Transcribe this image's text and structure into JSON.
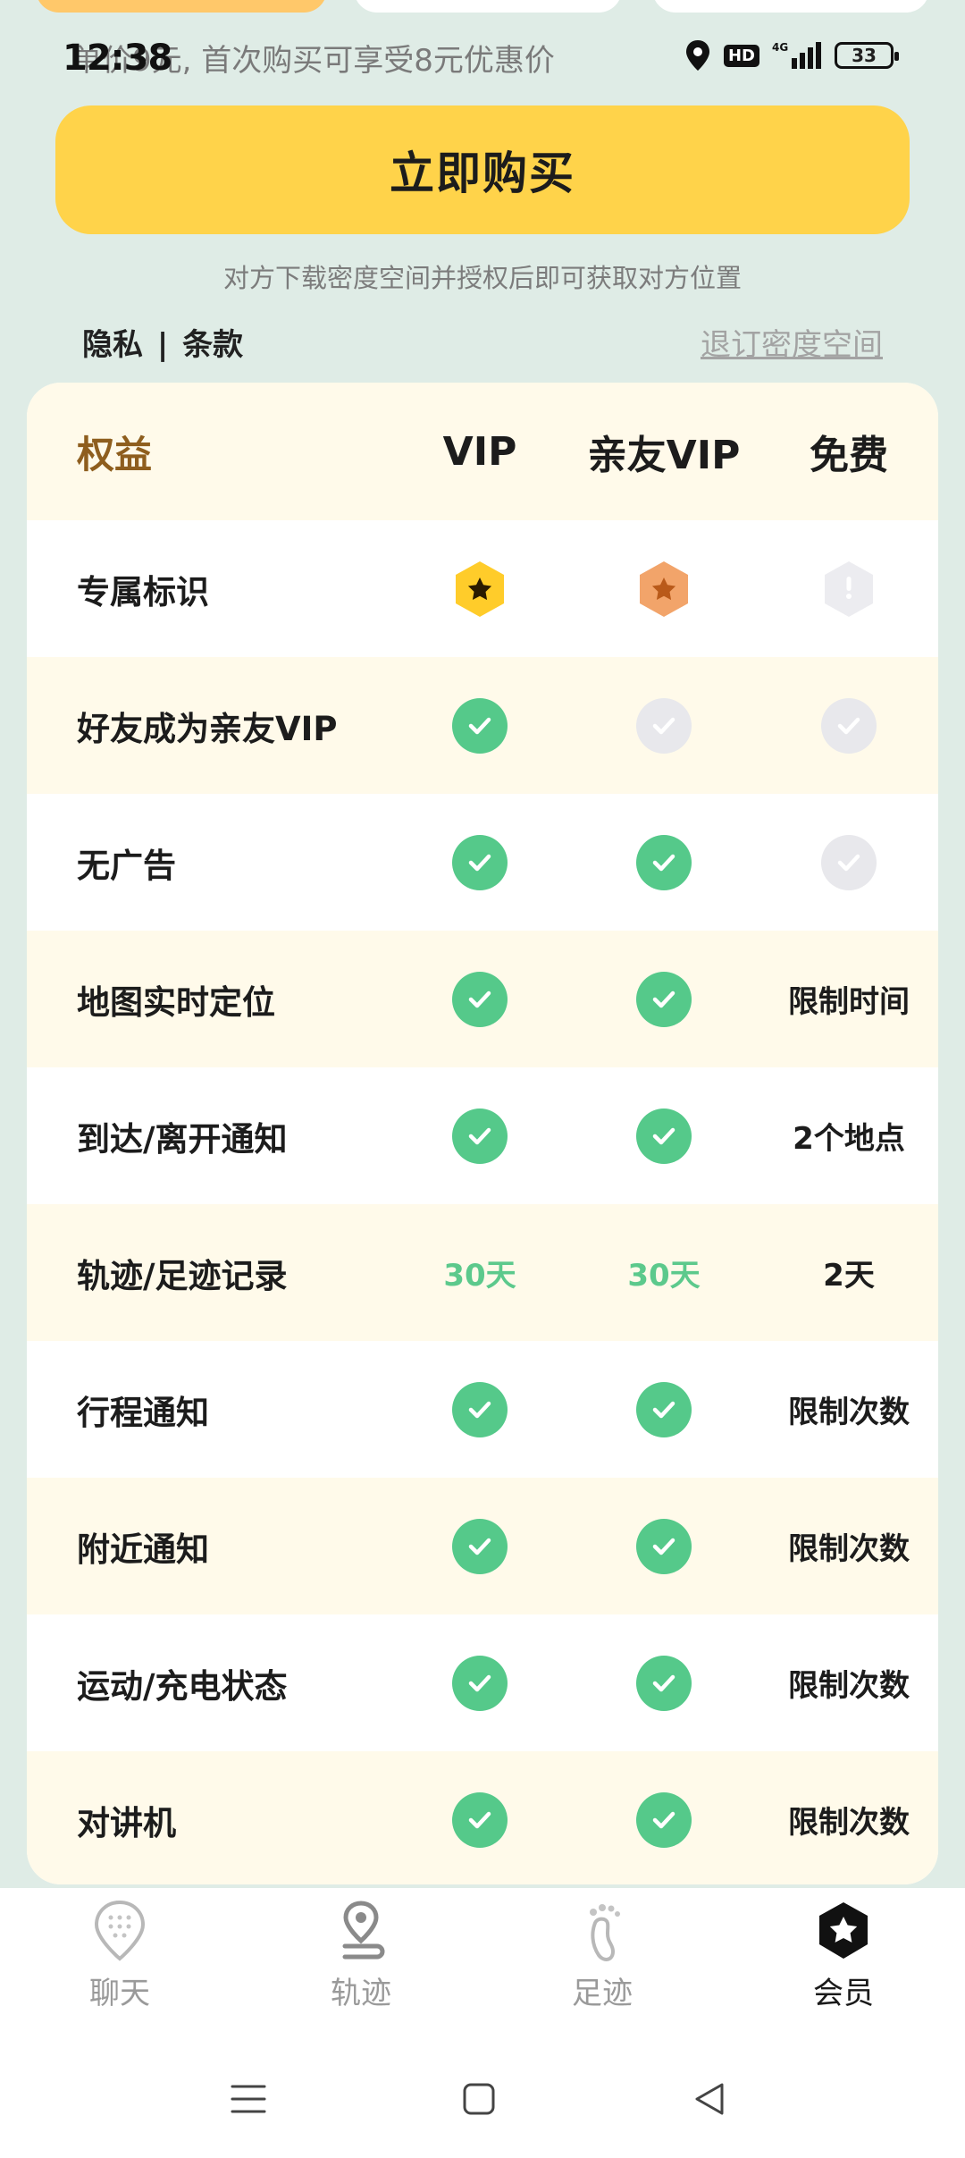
{
  "status_bar": {
    "time": "12:38",
    "network": "4G",
    "battery": "33"
  },
  "promo_text": "单价9元, 首次购买可享受8元优惠价",
  "buy_button": "立即购买",
  "note": "对方下载密度空间并授权后即可获取对方位置",
  "links": {
    "privacy": "隐私",
    "separator": "|",
    "terms": "条款",
    "unsubscribe": "退订密度空间"
  },
  "table": {
    "header": {
      "feature": "权益",
      "vip": "VIP",
      "family_vip": "亲友VIP",
      "free": "免费"
    },
    "rows": [
      {
        "feature": "专属标识",
        "vip": "gold-star-badge",
        "family_vip": "orange-star-badge",
        "free": "grey-exclamation-badge"
      },
      {
        "feature": "好友成为亲友VIP",
        "vip": "check",
        "family_vip": "check-off",
        "free": "check-off"
      },
      {
        "feature": "无广告",
        "vip": "check",
        "family_vip": "check",
        "free": "check-off"
      },
      {
        "feature": "地图实时定位",
        "vip": "check",
        "family_vip": "check",
        "free": "限制时间"
      },
      {
        "feature": "到达/离开通知",
        "vip": "check",
        "family_vip": "check",
        "free": "2个地点"
      },
      {
        "feature": "轨迹/足迹记录",
        "vip": "30天",
        "family_vip": "30天",
        "free": "2天"
      },
      {
        "feature": "行程通知",
        "vip": "check",
        "family_vip": "check",
        "free": "限制次数"
      },
      {
        "feature": "附近通知",
        "vip": "check",
        "family_vip": "check",
        "free": "限制次数"
      },
      {
        "feature": "运动/充电状态",
        "vip": "check",
        "family_vip": "check",
        "free": "限制次数"
      },
      {
        "feature": "对讲机",
        "vip": "check",
        "family_vip": "check",
        "free": "限制次数"
      }
    ]
  },
  "bottom_nav": [
    {
      "label": "聊天",
      "icon": "chat-icon"
    },
    {
      "label": "轨迹",
      "icon": "track-icon"
    },
    {
      "label": "足迹",
      "icon": "footprint-icon"
    },
    {
      "label": "会员",
      "icon": "member-icon",
      "active": true
    }
  ],
  "colors": {
    "accent": "#ffd34a",
    "check_green": "#55c98a",
    "header_brown": "#8e5e1e",
    "background": "#dfece6"
  }
}
